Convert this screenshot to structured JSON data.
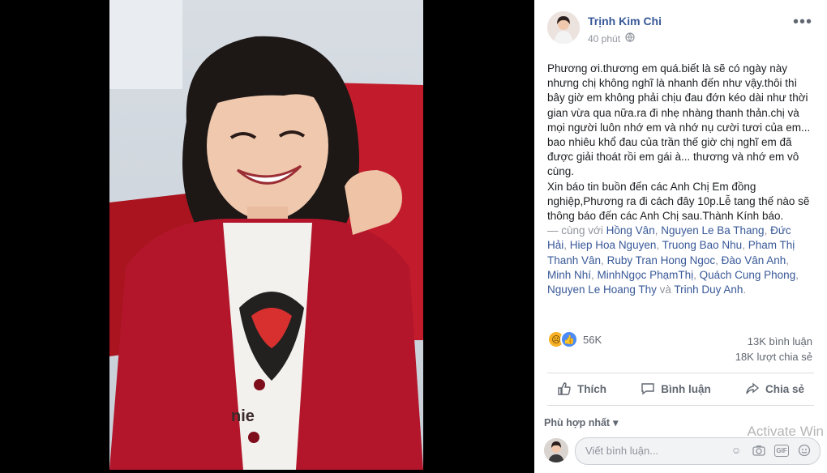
{
  "post": {
    "author": "Trịnh Kim Chi",
    "time": "40 phút",
    "text_lines": [
      "Phương ơi.thương em quá.biết là sẽ có ngày này nhưng chị không nghĩ là nhanh đến như vậy.thôi thì bây giờ em không phải chịu đau đớn kéo dài như thời gian vừa qua nữa.ra đi nhẹ nhàng thanh thản.chị và mọi người luôn nhớ em và nhớ nụ cười tươi của em... bao nhiêu khổ đau của trần thế giờ chị nghĩ em đã được giải thoát rồi em gái à... thương và nhớ em vô cùng.",
      "Xin báo tin buồn đến các Anh Chị Em đồng nghiệp,Phương ra đi cách đây 10p.Lễ tang thế nào sẽ thông báo đến các Anh Chị sau.Thành Kính báo."
    ],
    "with_label": "— cùng với",
    "tagged": [
      "Hồng Vân",
      "Nguyen Le Ba Thang",
      "Đức Hải",
      "Hiep Hoa Nguyen",
      "Truong Bao Nhu",
      "Pham Thị Thanh Vân",
      "Ruby Tran Hong Ngoc",
      "Đào Vân Anh",
      "Minh Nhí",
      "MinhNgọc PhạmThị",
      "Quách Cung Phong",
      "Nguyen Le Hoang Thy"
    ],
    "and_label": "và",
    "last_tagged": "Trinh Duy Anh",
    "reactions_count": "56K",
    "comments_count": "13K bình luận",
    "shares_count": "18K lượt chia sẻ"
  },
  "actions": {
    "like": "Thích",
    "comment": "Bình luận",
    "share": "Chia sẻ"
  },
  "comments": {
    "filter": "Phù hợp nhất",
    "placeholder": "Viết bình luận...",
    "gif_label": "GIF"
  },
  "watermark": "Activate Win",
  "colors": {
    "link": "#385898",
    "text": "#1c1e21",
    "muted": "#90949c",
    "like_blue": "#4c8bf5",
    "sad_yellow": "#f7b125",
    "cardigan_red": "#b3162b"
  },
  "icons": [
    "globe-icon",
    "more-icon",
    "sad-reaction-icon",
    "like-reaction-icon",
    "thumbs-up-icon",
    "comment-icon",
    "share-icon",
    "caret-down-icon",
    "emoji-icon",
    "camera-icon",
    "gif-icon",
    "sticker-icon"
  ]
}
